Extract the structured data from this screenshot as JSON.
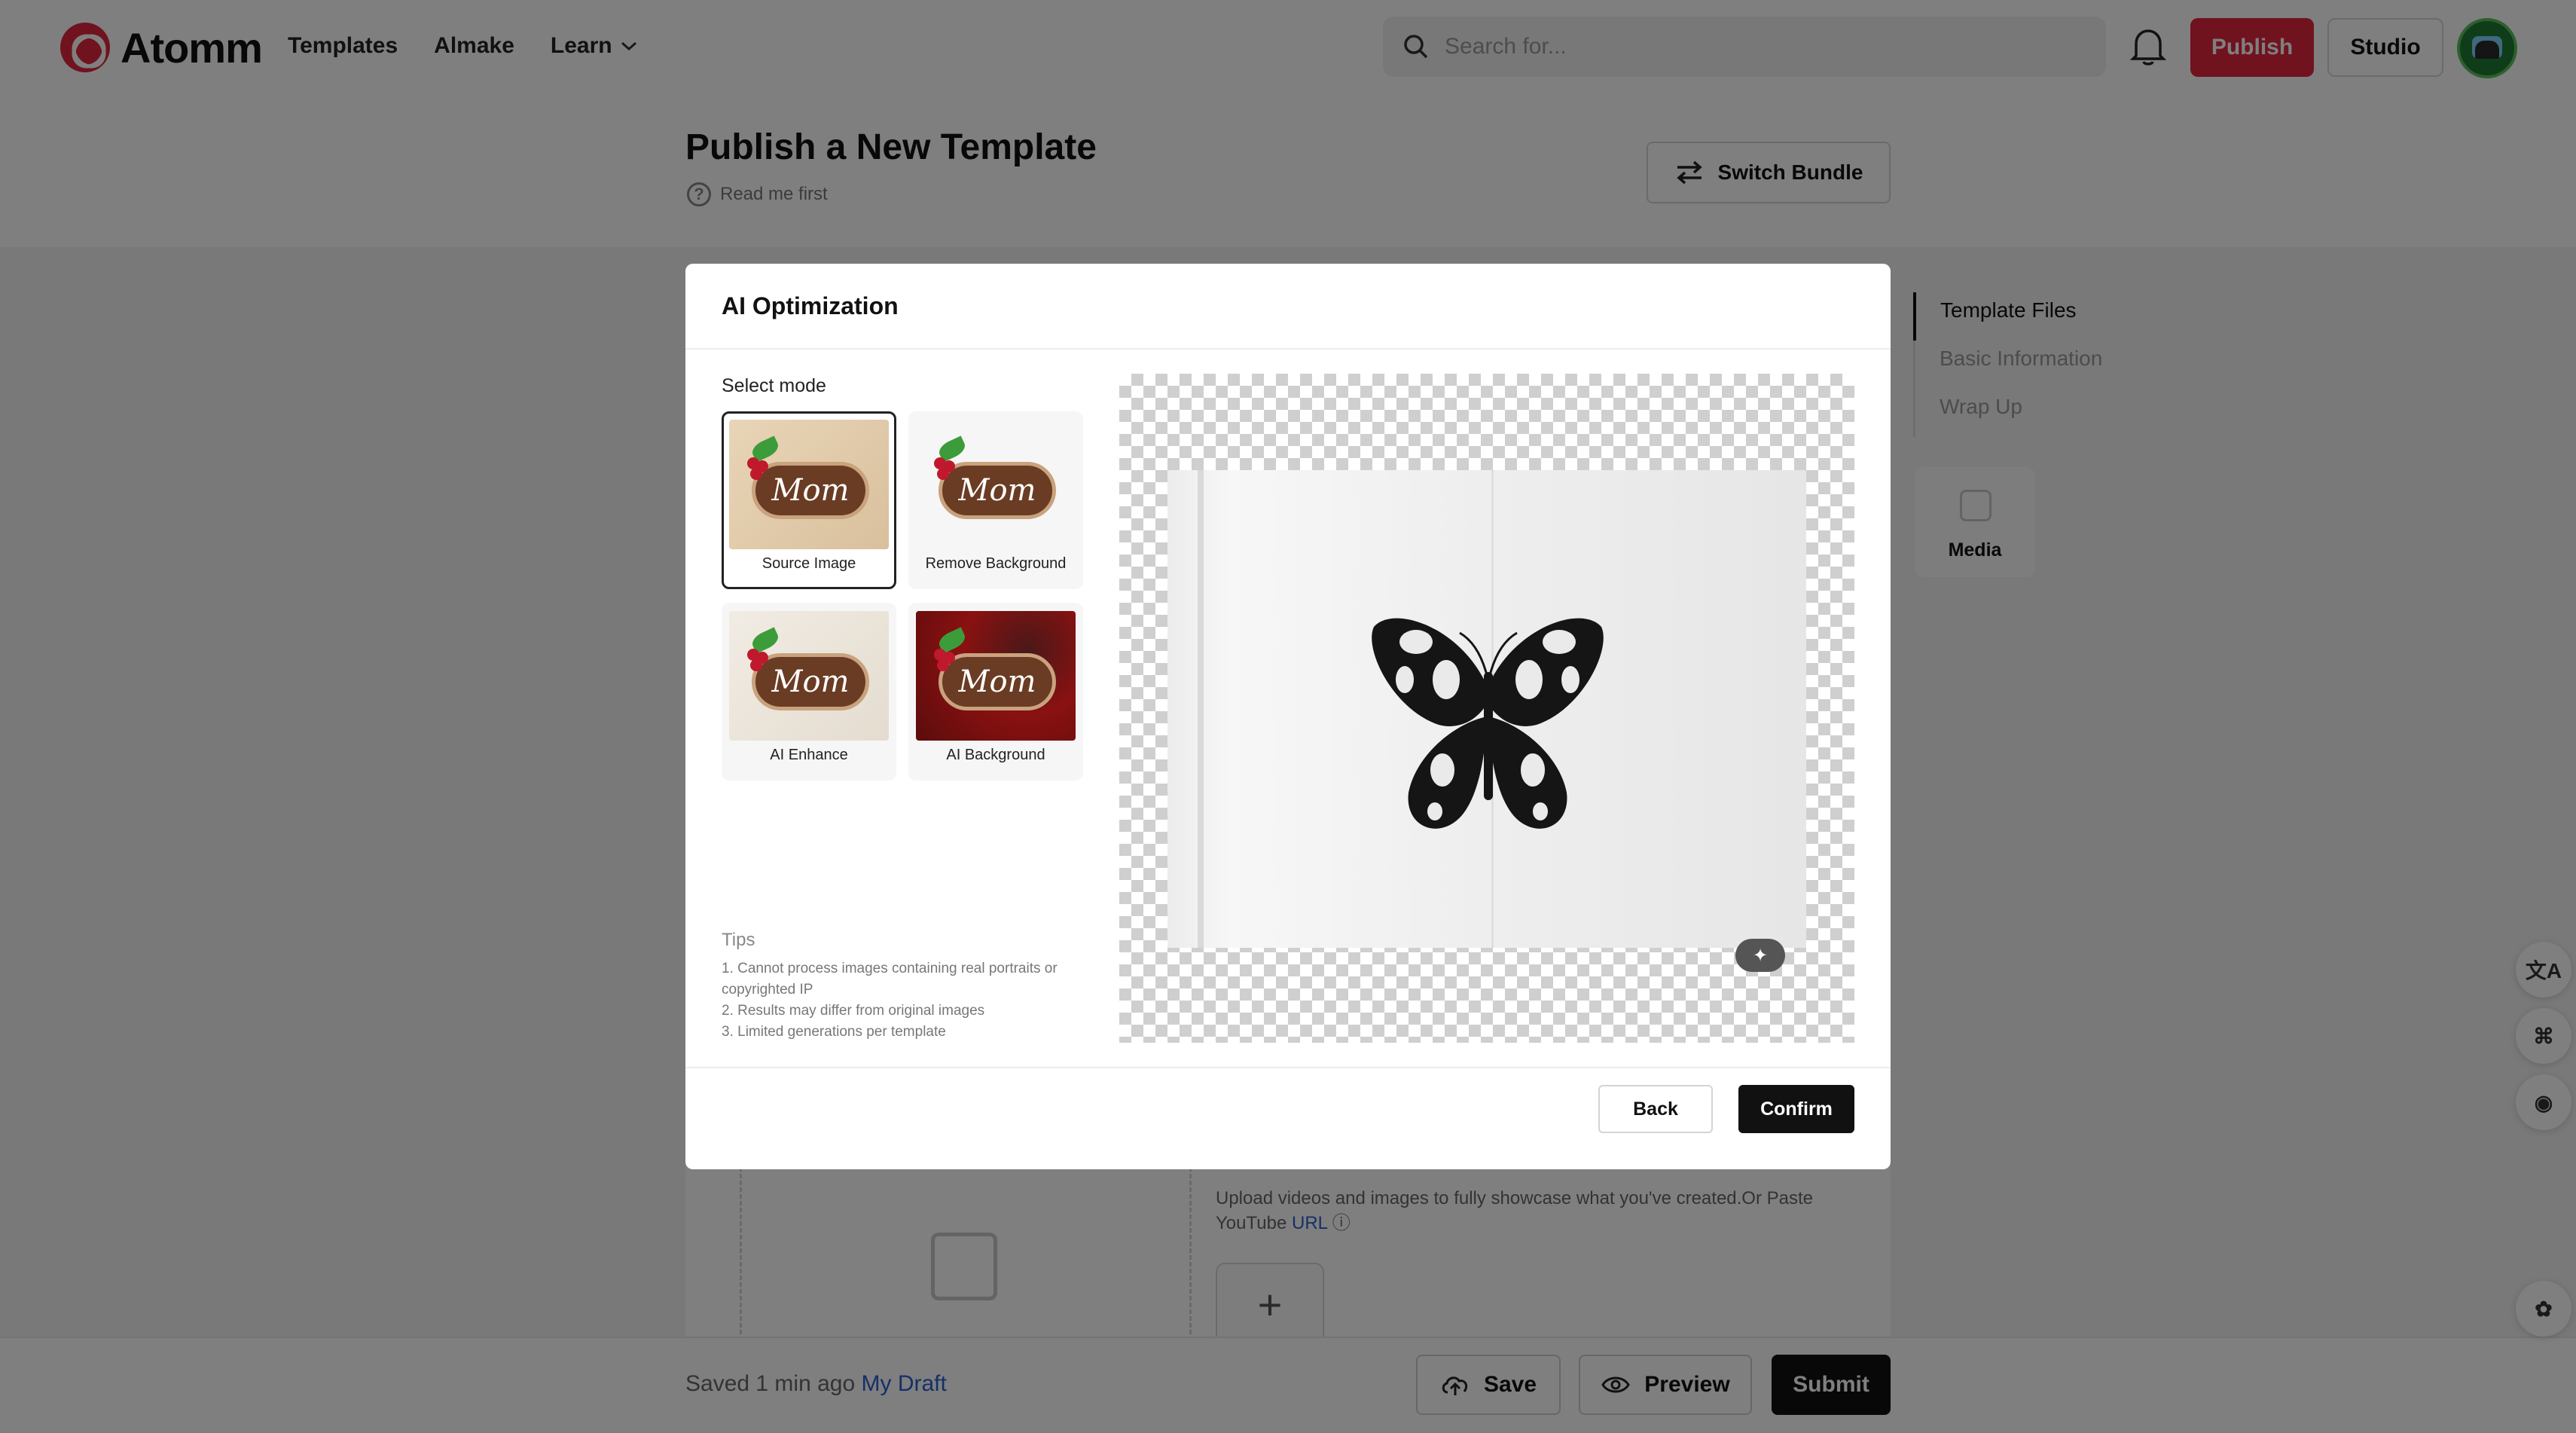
{
  "header": {
    "logo_text": "Atomm",
    "nav": [
      "Templates",
      "Almake",
      "Learn"
    ],
    "search_placeholder": "Search for...",
    "publish_label": "Publish",
    "studio_label": "Studio"
  },
  "page": {
    "title": "Publish a New Template",
    "read_me": "Read me first",
    "switch_bundle": "Switch Bundle"
  },
  "side_nav": {
    "items": [
      "Template Files",
      "Basic Information",
      "Wrap Up"
    ],
    "media_label": "Media"
  },
  "background_content": {
    "upload_text": "Upload videos and images to fully showcase what you've created.Or Paste YouTube",
    "url_link": "URL",
    "add_symbol": "+"
  },
  "footer": {
    "saved_text": "Saved 1 min ago",
    "draft_link": "My Draft",
    "save_label": "Save",
    "preview_label": "Preview",
    "submit_label": "Submit"
  },
  "modal": {
    "title": "AI Optimization",
    "select_mode": "Select mode",
    "modes": [
      {
        "label": "Source Image",
        "thumb_text": "Mom"
      },
      {
        "label": "Remove Background",
        "thumb_text": "Mom"
      },
      {
        "label": "AI Enhance",
        "thumb_text": "Mom"
      },
      {
        "label": "AI Background",
        "thumb_text": "Mom"
      }
    ],
    "selected_mode": "Source Image",
    "tips": {
      "title": "Tips",
      "items": [
        "1. Cannot process images containing real portraits or copyrighted IP",
        "2. Results may differ from original images",
        "3. Limited generations per template"
      ]
    },
    "back_label": "Back",
    "confirm_label": "Confirm"
  },
  "colors": {
    "brand_red": "#e0263e",
    "link_blue": "#2a5fd0",
    "dark_button": "#111111"
  }
}
